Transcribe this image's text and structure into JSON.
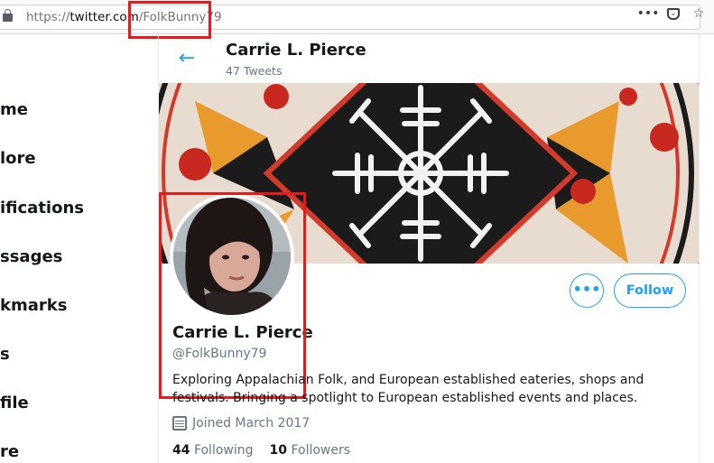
{
  "browser": {
    "url_prefix": "https://",
    "url_host": "twitter.com",
    "url_path": "/FolkBunny79",
    "more_icon": "ellipsis-icon",
    "pocket_icon": "pocket-icon",
    "bookmark_icon": "star-icon"
  },
  "nav": {
    "items": [
      "me",
      "lore",
      "ifications",
      "ssages",
      "kmarks",
      "s",
      "file",
      "re"
    ]
  },
  "header": {
    "name": "Carrie L. Pierce",
    "tweet_count": "47 Tweets"
  },
  "profile": {
    "name": "Carrie L. Pierce",
    "handle": "@FolkBunny79",
    "bio": "Exploring Appalachian Folk, and European established eateries, shops and festivals. Bringing a spotlight to European established events and places.",
    "joined": "Joined March 2017",
    "following_count": "44",
    "following_label": "Following",
    "followers_count": "10",
    "followers_label": "Followers",
    "follow_button": "Follow",
    "more_button": "•••"
  },
  "colors": {
    "accent": "#1da1f2",
    "annotation": "#e8191b"
  }
}
